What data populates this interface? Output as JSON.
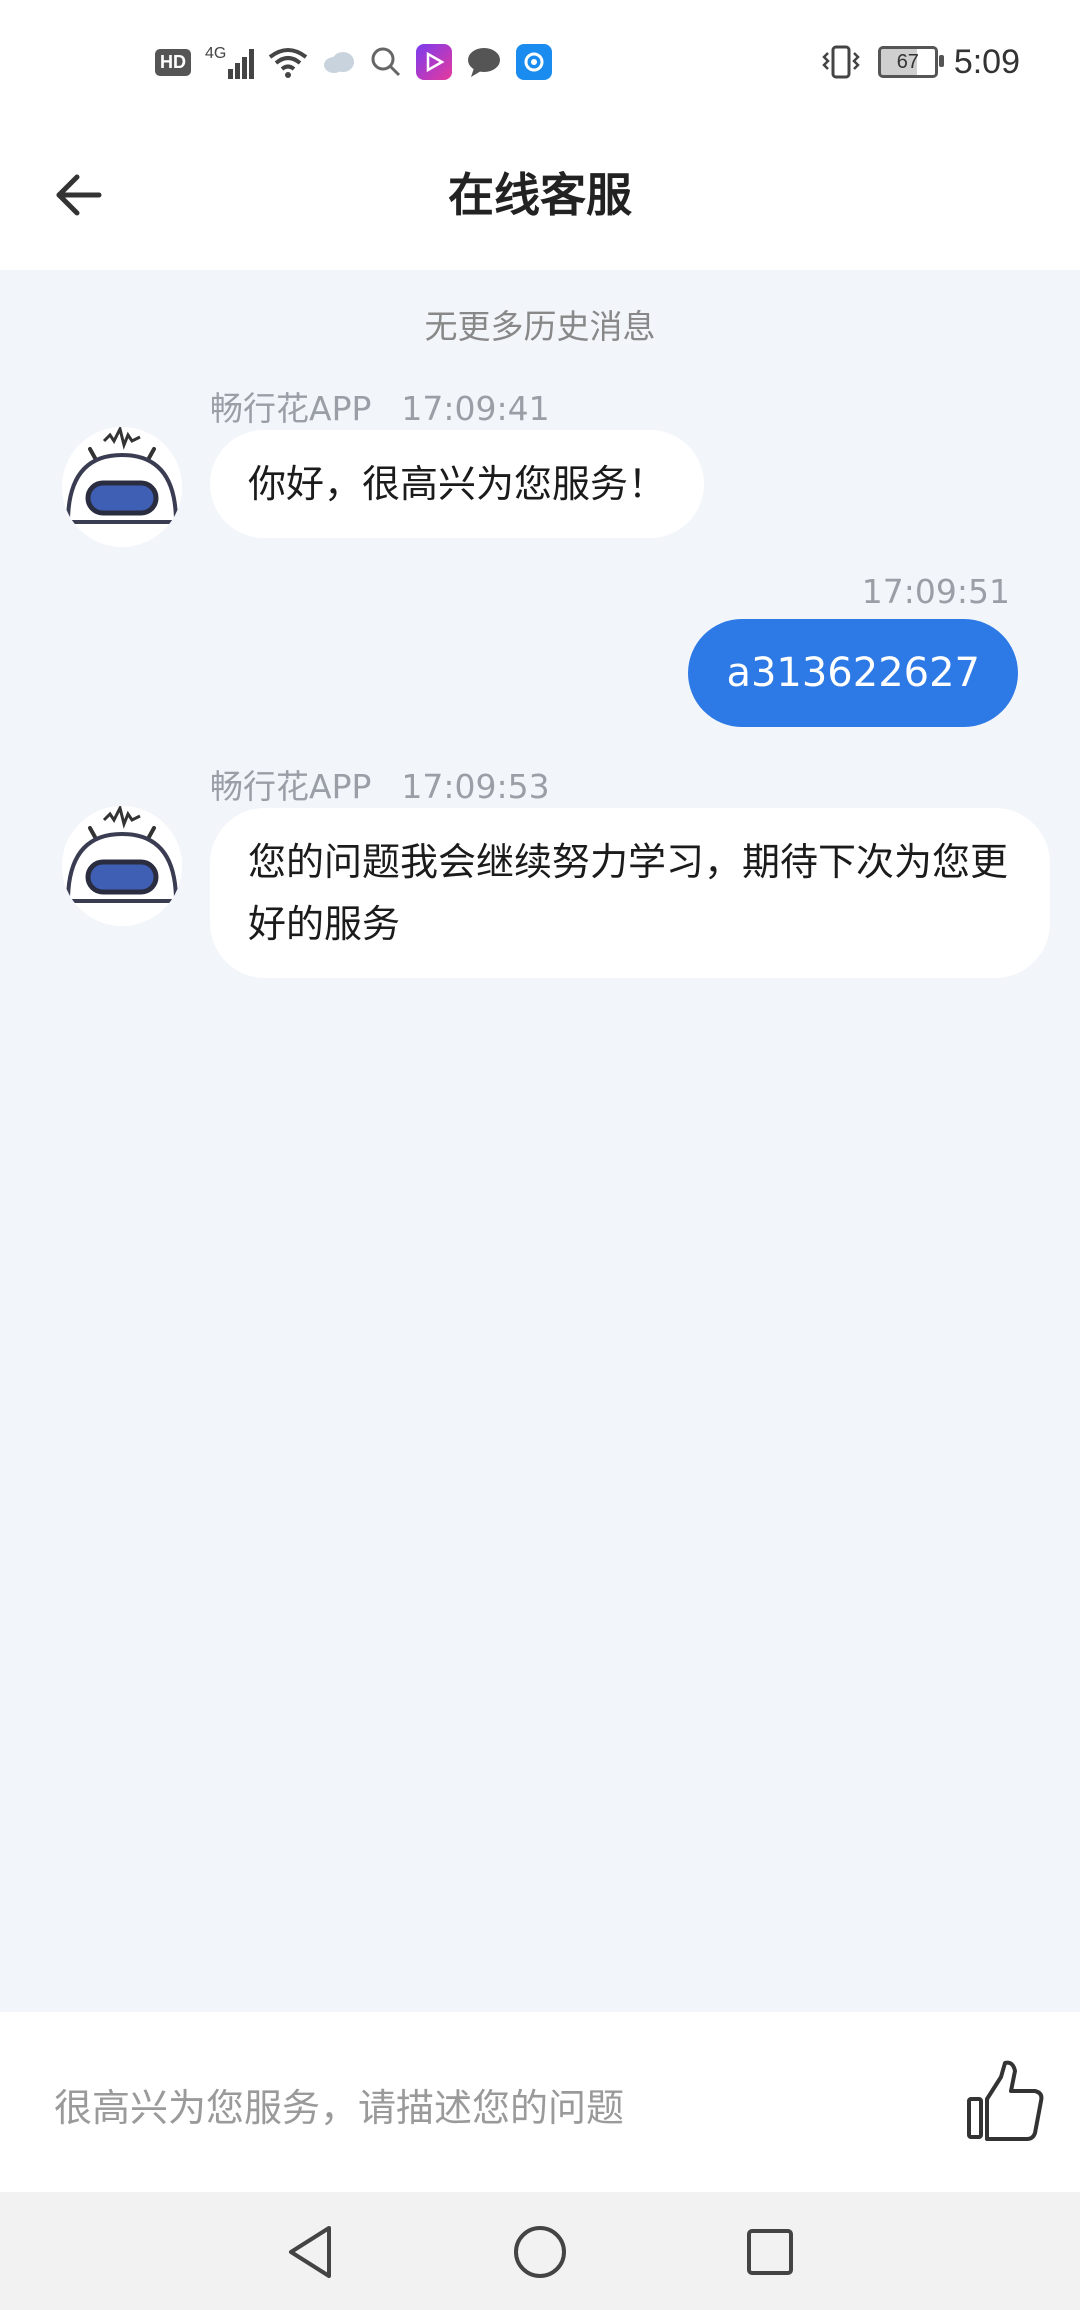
{
  "status_bar": {
    "hd": "HD",
    "network": "4G",
    "battery": "67",
    "time": "5:09"
  },
  "header": {
    "title": "在线客服",
    "back_icon": "arrow-left-icon"
  },
  "chat": {
    "history_note": "无更多历史消息",
    "messages": [
      {
        "from": "bot",
        "sender": "畅行花APP",
        "time": "17:09:41",
        "text": "你好，很高兴为您服务！"
      },
      {
        "from": "user",
        "time": "17:09:51",
        "text": "a313622627"
      },
      {
        "from": "bot",
        "sender": "畅行花APP",
        "time": "17:09:53",
        "text": "您的问题我会继续努力学习，期待下次为您更好的服务"
      }
    ]
  },
  "input": {
    "placeholder": "很高兴为您服务，请描述您的问题",
    "value": "",
    "like_icon": "thumbs-up-icon"
  },
  "colors": {
    "accent": "#2d79e6",
    "background": "#f2f6fa"
  }
}
